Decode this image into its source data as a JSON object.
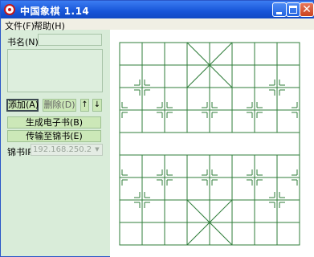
{
  "window": {
    "title": "中国象棋 1.14"
  },
  "menu": [
    {
      "label": "文件(F)"
    },
    {
      "label": "帮助(H)"
    }
  ],
  "sidebar": {
    "bookname_label": "书名(N):",
    "bookname_value": "",
    "add_button": "添加(A)",
    "delete_button": "删除(D)",
    "up_button": "↑",
    "down_button": "↓",
    "generate_button": "生成电子书(B)",
    "send_button": "传输至锦书(E)",
    "ip_label": "锦书IP",
    "ip_value": "192.168.250.2"
  },
  "board": {
    "files": 9,
    "ranks": 10,
    "line_color": "#2f7d3a"
  }
}
